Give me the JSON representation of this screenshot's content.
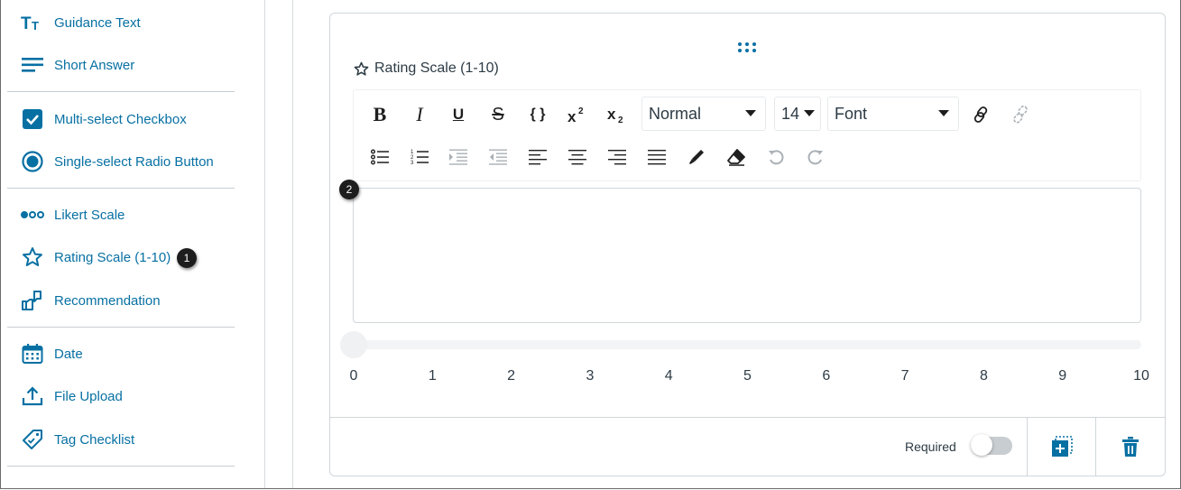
{
  "sidebar": {
    "items": [
      {
        "label": "Guidance Text",
        "icon": "text-size-icon"
      },
      {
        "label": "Short Answer",
        "icon": "short-answer-icon"
      },
      {
        "label": "Multi-select Checkbox",
        "icon": "checkbox-icon"
      },
      {
        "label": "Single-select Radio Button",
        "icon": "radio-button-icon"
      },
      {
        "label": "Likert Scale",
        "icon": "likert-dots-icon"
      },
      {
        "label": "Rating Scale (1-10)",
        "icon": "star-icon"
      },
      {
        "label": "Recommendation",
        "icon": "thumbs-icon"
      },
      {
        "label": "Date",
        "icon": "calendar-icon"
      },
      {
        "label": "File Upload",
        "icon": "upload-icon"
      },
      {
        "label": "Tag Checklist",
        "icon": "tag-icon"
      }
    ]
  },
  "callouts": {
    "one": "1",
    "two": "2"
  },
  "question": {
    "title": "Rating Scale (1-10)"
  },
  "toolbar": {
    "bold": "B",
    "italic": "I",
    "underline": "U",
    "strike": "S",
    "code": "{ }",
    "block_format": "Normal",
    "font_size": "14",
    "font_family": "Font"
  },
  "slider": {
    "value": 0,
    "min": 0,
    "max": 10,
    "ticks": [
      "0",
      "1",
      "2",
      "3",
      "4",
      "5",
      "6",
      "7",
      "8",
      "9",
      "10"
    ]
  },
  "footer": {
    "required_label": "Required",
    "required_on": false
  },
  "colors": {
    "accent": "#0770a3",
    "text": "#2d3b45",
    "border": "#d0d6da"
  }
}
